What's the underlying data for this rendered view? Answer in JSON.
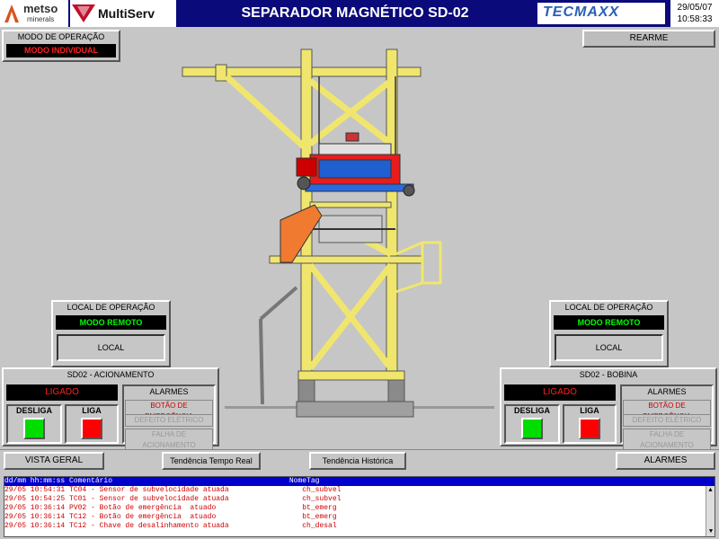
{
  "header": {
    "logo_metso": "metso",
    "logo_metso_sub": "minerals",
    "logo_multiserv": "MultiServ",
    "title": "SEPARADOR MAGNÉTICO SD-02",
    "brand": "TECMAXX",
    "date": "29/05/07",
    "time": "10:58:33"
  },
  "mode": {
    "label": "MODO DE OPERAÇÃO",
    "value": "MODO INDIVIDUAL"
  },
  "rearme_label": "REARME",
  "colors": {
    "header_bg": "#0a0a7a",
    "structure": "#f0e66e",
    "magnet": "#e81c1c",
    "red_on": "#ff0000",
    "green_on": "#00dd00",
    "remote_green": "#00ff00"
  },
  "left_local": {
    "title": "LOCAL DE OPERAÇÃO",
    "remote": "MODO REMOTO",
    "local_button": "LOCAL"
  },
  "right_local": {
    "title": "LOCAL DE OPERAÇÃO",
    "remote": "MODO REMOTO",
    "local_button": "LOCAL"
  },
  "left_panel": {
    "title": "SD02 - ACIONAMENTO",
    "status": "LIGADO",
    "desliga": "DESLIGA",
    "liga": "LIGA",
    "alarmes_title": "ALARMES",
    "alarms": [
      "BOTÃO DE EMERGÊNCIA",
      "DEFEITO ELÉTRICO",
      "FALHA DE ACIONAMENTO"
    ]
  },
  "right_panel": {
    "title": "SD02 - BOBINA",
    "status": "LIGADO",
    "desliga": "DESLIGA",
    "liga": "LIGA",
    "alarmes_title": "ALARMES",
    "alarms": [
      "BOTÃO DE EMERGÊNCIA",
      "DEFEITO ELÉTRICO",
      "FALHA DE ACIONAMENTO"
    ]
  },
  "nav": {
    "vista_geral": "VISTA GERAL",
    "tendencia_real": "Tendência Tempo Real",
    "tendencia_historica": "Tendência Histórica",
    "alarmes": "ALARMES"
  },
  "log": {
    "header": "dd/mm hh:mm:ss Comentário                                         NomeTag",
    "rows": [
      "29/05 10:54:31 TC04 - Sensor de subvelocidade atuada                 ch_subvel",
      "29/05 10:54:25 TC01 - Sensor de subvelocidade atuada                 ch_subvel",
      "29/05 10:36:14 PV02 - Botão de emergência  atuado                    bt_emerg",
      "29/05 10:36:14 TC12 - Botão de emergência  atuado                    bt_emerg",
      "29/05 10:36:14 TC12 - Chave de desalinhamento atuada                 ch_desal"
    ]
  }
}
